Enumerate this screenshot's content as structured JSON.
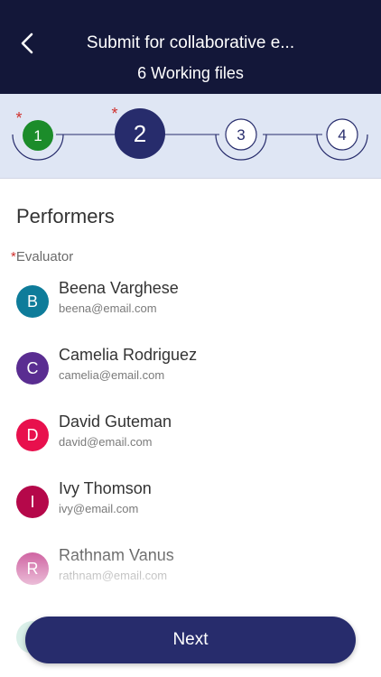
{
  "header": {
    "title": "Submit for collaborative e...",
    "subtitle": "6 Working files"
  },
  "stepper": {
    "steps": [
      {
        "label": "1",
        "state": "completed",
        "required": true
      },
      {
        "label": "2",
        "state": "current",
        "required": true
      },
      {
        "label": "3",
        "state": "upcoming",
        "required": false
      },
      {
        "label": "4",
        "state": "upcoming",
        "required": false
      }
    ],
    "required_mark": "*"
  },
  "section": {
    "title": "Performers"
  },
  "field": {
    "required_mark": "*",
    "label": "Evaluator"
  },
  "performers": [
    {
      "initial": "B",
      "name": "Beena Varghese",
      "email": "beena@email.com",
      "color": "#0e7c9a"
    },
    {
      "initial": "C",
      "name": "Camelia Rodriguez",
      "email": "camelia@email.com",
      "color": "#5a2d91"
    },
    {
      "initial": "D",
      "name": "David Guteman",
      "email": "david@email.com",
      "color": "#e8104d"
    },
    {
      "initial": "I",
      "name": "Ivy Thomson",
      "email": "ivy@email.com",
      "color": "#b5084a"
    },
    {
      "initial": "R",
      "name": "Rathnam Vanus",
      "email": "rathnam@email.com",
      "color": "#bf2e82"
    }
  ],
  "actions": {
    "next_label": "Next"
  },
  "colors": {
    "header_bg": "#131739",
    "stepper_bg": "#dfe6f4",
    "step_completed": "#1c8c2a",
    "step_current": "#272c6c",
    "required_mark": "#d0312d",
    "button_bg": "#272c6c"
  }
}
